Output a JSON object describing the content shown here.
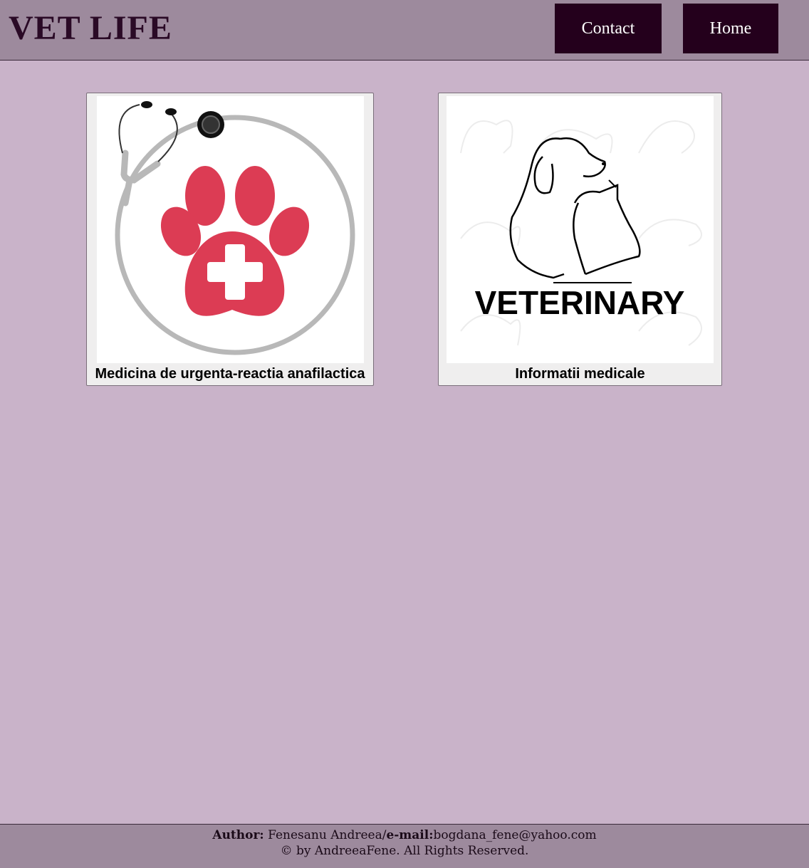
{
  "header": {
    "logo": "VET LIFE",
    "nav": {
      "contact_label": "Contact",
      "home_label": "Home"
    }
  },
  "cards": [
    {
      "caption": "Medicina de urgenta-reactia anafilactica",
      "icon": "paw-stethoscope-icon"
    },
    {
      "caption": "Informatii medicale",
      "icon": "dog-cat-veterinary-logo",
      "logo_text": "VETERINARY"
    }
  ],
  "footer": {
    "author_label": "Author:",
    "author_name": " Fenesanu Andreea/",
    "email_label": "e-mail:",
    "email": "bogdana_fene@yahoo.com",
    "copyright": "© by AndreeaFene. All Rights Reserved."
  },
  "colors": {
    "background": "#c9b3c9",
    "header": "#9d8a9d",
    "nav_button": "#24001c",
    "accent_red": "#dc3c54"
  }
}
